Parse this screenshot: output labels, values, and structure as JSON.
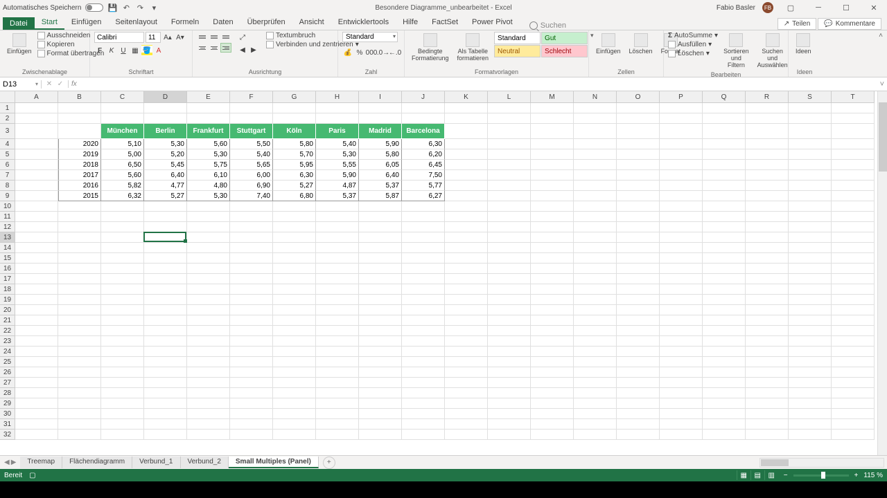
{
  "titlebar": {
    "autosave": "Automatisches Speichern",
    "doc_title": "Besondere Diagramme_unbearbeitet - Excel",
    "user": "Fabio Basler",
    "initials": "FB"
  },
  "tabs": {
    "file": "Datei",
    "list": [
      "Start",
      "Einfügen",
      "Seitenlayout",
      "Formeln",
      "Daten",
      "Überprüfen",
      "Ansicht",
      "Entwicklertools",
      "Hilfe",
      "FactSet",
      "Power Pivot"
    ],
    "active": 0,
    "search": "Suchen",
    "share": "Teilen",
    "comments": "Kommentare"
  },
  "ribbon": {
    "clipboard": {
      "label": "Zwischenablage",
      "paste": "Einfügen",
      "cut": "Ausschneiden",
      "copy": "Kopieren",
      "format": "Format übertragen"
    },
    "font": {
      "label": "Schriftart",
      "name": "Calibri",
      "size": "11"
    },
    "align": {
      "label": "Ausrichtung",
      "wrap": "Textumbruch",
      "merge": "Verbinden und zentrieren"
    },
    "number": {
      "label": "Zahl",
      "format": "Standard"
    },
    "cond": {
      "cond": "Bedingte\nFormatierung",
      "table": "Als Tabelle\nformatieren",
      "label": "Formatvorlagen"
    },
    "styles": {
      "standard": "Standard",
      "gut": "Gut",
      "neutral": "Neutral",
      "schlecht": "Schlecht"
    },
    "cells": {
      "label": "Zellen",
      "insert": "Einfügen",
      "delete": "Löschen",
      "format": "Format"
    },
    "editing": {
      "label": "Bearbeiten",
      "sum": "AutoSumme",
      "fill": "Ausfüllen",
      "clear": "Löschen",
      "sort": "Sortieren und\nFiltern",
      "find": "Suchen und\nAuswählen"
    },
    "ideas": {
      "label": "Ideen",
      "btn": "Ideen"
    }
  },
  "namebox": "D13",
  "columns": [
    "A",
    "B",
    "C",
    "D",
    "E",
    "F",
    "G",
    "H",
    "I",
    "J",
    "K",
    "L",
    "M",
    "N",
    "O",
    "P",
    "Q",
    "R",
    "S",
    "T"
  ],
  "sel_col_idx": 3,
  "sel_row_idx": 12,
  "table": {
    "headers": [
      "München",
      "Berlin",
      "Frankfurt",
      "Stuttgart",
      "Köln",
      "Paris",
      "Madrid",
      "Barcelona"
    ],
    "years": [
      "2020",
      "2019",
      "2018",
      "2017",
      "2016",
      "2015"
    ],
    "data": [
      [
        "5,10",
        "5,30",
        "5,60",
        "5,50",
        "5,80",
        "5,40",
        "5,90",
        "6,30"
      ],
      [
        "5,00",
        "5,20",
        "5,30",
        "5,40",
        "5,70",
        "5,30",
        "5,80",
        "6,20"
      ],
      [
        "6,50",
        "5,45",
        "5,75",
        "5,65",
        "5,95",
        "5,55",
        "6,05",
        "6,45"
      ],
      [
        "5,60",
        "6,40",
        "6,10",
        "6,00",
        "6,30",
        "5,90",
        "6,40",
        "7,50"
      ],
      [
        "5,82",
        "4,77",
        "4,80",
        "6,90",
        "5,27",
        "4,87",
        "5,37",
        "5,77"
      ],
      [
        "6,32",
        "5,27",
        "5,30",
        "7,40",
        "6,80",
        "5,37",
        "5,87",
        "6,27"
      ]
    ]
  },
  "sheets": {
    "list": [
      "Treemap",
      "Flächendiagramm",
      "Verbund_1",
      "Verbund_2",
      "Small Multiples (Panel)"
    ],
    "active": 4
  },
  "status": {
    "ready": "Bereit",
    "zoom": "115 %"
  },
  "chart_data": {
    "type": "table",
    "title": "",
    "columns": [
      "München",
      "Berlin",
      "Frankfurt",
      "Stuttgart",
      "Köln",
      "Paris",
      "Madrid",
      "Barcelona"
    ],
    "index": [
      2020,
      2019,
      2018,
      2017,
      2016,
      2015
    ],
    "values": [
      [
        5.1,
        5.3,
        5.6,
        5.5,
        5.8,
        5.4,
        5.9,
        6.3
      ],
      [
        5.0,
        5.2,
        5.3,
        5.4,
        5.7,
        5.3,
        5.8,
        6.2
      ],
      [
        6.5,
        5.45,
        5.75,
        5.65,
        5.95,
        5.55,
        6.05,
        6.45
      ],
      [
        5.6,
        6.4,
        6.1,
        6.0,
        6.3,
        5.9,
        6.4,
        7.5
      ],
      [
        5.82,
        4.77,
        4.8,
        6.9,
        5.27,
        4.87,
        5.37,
        5.77
      ],
      [
        6.32,
        5.27,
        5.3,
        7.4,
        6.8,
        5.37,
        5.87,
        6.27
      ]
    ]
  }
}
